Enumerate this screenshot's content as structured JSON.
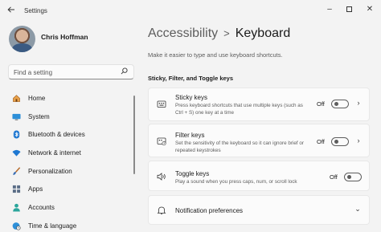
{
  "window": {
    "title": "Settings",
    "back_icon": "arrow-left-icon",
    "minimize_glyph": "–",
    "close_glyph": "✕"
  },
  "profile": {
    "name": "Chris Hoffman"
  },
  "search": {
    "placeholder": "Find a setting"
  },
  "nav": {
    "items": [
      {
        "label": "Home",
        "icon": "home-icon"
      },
      {
        "label": "System",
        "icon": "monitor-icon"
      },
      {
        "label": "Bluetooth & devices",
        "icon": "bluetooth-icon"
      },
      {
        "label": "Network & internet",
        "icon": "wifi-icon"
      },
      {
        "label": "Personalization",
        "icon": "brush-icon"
      },
      {
        "label": "Apps",
        "icon": "apps-icon"
      },
      {
        "label": "Accounts",
        "icon": "person-icon"
      },
      {
        "label": "Time & language",
        "icon": "globe-clock-icon"
      }
    ]
  },
  "header": {
    "parent": "Accessibility",
    "separator": ">",
    "current": "Keyboard",
    "description": "Make it easier to type and use keyboard shortcuts."
  },
  "section": {
    "title": "Sticky, Filter, and Toggle keys"
  },
  "settings": [
    {
      "title": "Sticky keys",
      "description": "Press keyboard shortcuts that use multiple keys (such as Ctrl + S) one key at a time",
      "state": "Off",
      "icon": "sticky-keys-icon"
    },
    {
      "title": "Filter keys",
      "description": "Set the sensitivity of the keyboard so it can ignore brief or repeated keystrokes",
      "state": "Off",
      "icon": "filter-keys-icon"
    },
    {
      "title": "Toggle keys",
      "description": "Play a sound when you press caps, num, or scroll lock",
      "state": "Off",
      "icon": "speaker-icon"
    },
    {
      "title": "Notification preferences",
      "icon": "bell-icon"
    }
  ],
  "colors": {
    "background": "#f3f3f3",
    "card": "#fbfbfb",
    "accent_blue": "#0067c0"
  }
}
